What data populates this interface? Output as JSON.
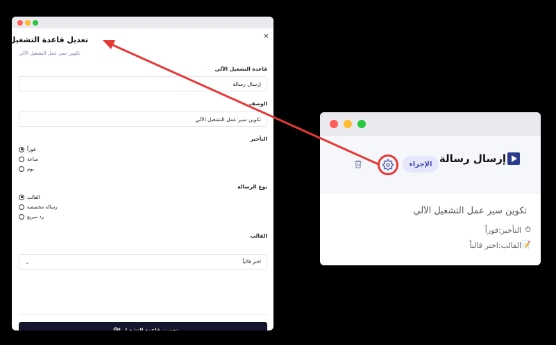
{
  "modal": {
    "close": "×",
    "title": "تعديل قاعدة التشغيل الآلي",
    "subtitle": "تكوين سير عمل التشغيل الآلي",
    "rule_label": "قاعدة التشغيل الآلي",
    "rule_value": "إرسال رسالة",
    "desc_label": "الوصف",
    "desc_value": "تكوين سير عمل التشغيل الآلي",
    "delay_label": "التأخير",
    "delay_options": [
      "فوراً",
      "ساعة",
      "يوم"
    ],
    "msg_label": "نوع الرسالة",
    "msg_options": [
      "القالب",
      "رسالة مخصصة",
      "رد سريع"
    ],
    "template_label": "القالب",
    "template_placeholder": "اختر قالباً",
    "submit": "تحديث قاعدة التشغيل الآلي"
  },
  "card": {
    "title": "إرسال رسالة",
    "badge": "الإجراء",
    "description": "تكوين سير عمل التشغيل الآلي",
    "delay_meta": "التأخير:فوراً",
    "template_meta": "القالب:اختر قالباً",
    "icons": [
      "play-icon",
      "gear-icon",
      "trash-icon",
      "stopwatch-icon",
      "memo-icon"
    ]
  },
  "colors": {
    "highlight": "#e53935",
    "accent": "#2a3a8e",
    "submit_bg": "#14172b"
  }
}
